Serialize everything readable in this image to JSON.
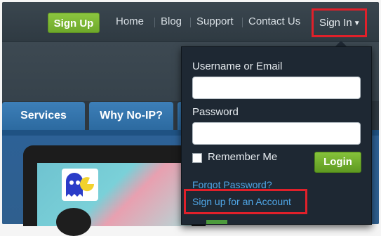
{
  "nav": {
    "signup_label": "Sign Up",
    "links": [
      "Home",
      "Blog",
      "Support",
      "Contact Us"
    ],
    "signin_label": "Sign In"
  },
  "tabs": [
    "Services",
    "Why No-IP?"
  ],
  "login_form": {
    "username_label": "Username or Email",
    "username_value": "",
    "password_label": "Password",
    "password_value": "",
    "remember_label": "Remember Me",
    "login_label": "Login",
    "forgot_label": "Forgot Password?",
    "signup_account_label": "Sign up for an Account"
  },
  "colors": {
    "accent_green": "#7bb833",
    "link_blue": "#4fa6e6",
    "highlight_red": "#e0202a",
    "tab_blue": "#3476ad"
  }
}
